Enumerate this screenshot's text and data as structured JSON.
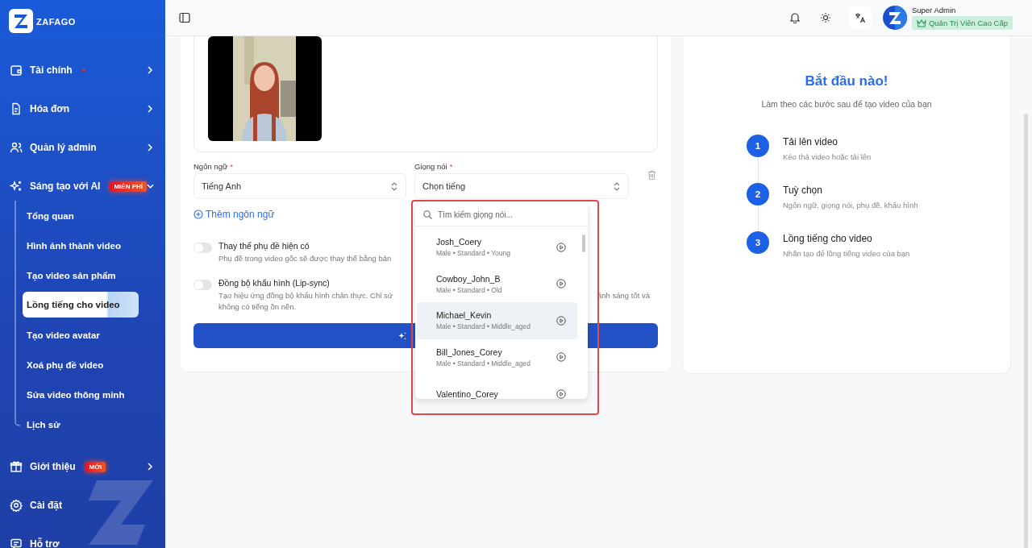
{
  "brand": {
    "name": "ZAFAGO"
  },
  "sidebar": {
    "items": [
      {
        "label": "Tài chính",
        "dot": true,
        "expanded": false
      },
      {
        "label": "Hóa đơn",
        "expanded": false
      },
      {
        "label": "Quản lý admin",
        "expanded": false
      },
      {
        "label": "Sáng tạo với AI",
        "badge": "MIỄN PHÍ",
        "expanded": true,
        "children": [
          {
            "label": "Tổng quan",
            "selected": false
          },
          {
            "label": "Hình ảnh thành video",
            "selected": false
          },
          {
            "label": "Tạo video sản phẩm",
            "selected": false
          },
          {
            "label": "Lồng tiếng cho video",
            "selected": true
          },
          {
            "label": "Tạo video avatar",
            "selected": false
          },
          {
            "label": "Xoá phụ đề video",
            "selected": false
          },
          {
            "label": "Sửa video thông minh",
            "selected": false
          },
          {
            "label": "Lịch sử",
            "selected": false
          }
        ]
      },
      {
        "label": "Giới thiệu",
        "badge": "MỚI",
        "expanded": false
      },
      {
        "label": "Cài đặt"
      },
      {
        "label": "Hỗ trợ"
      }
    ]
  },
  "header": {
    "user_name": "Super Admin",
    "role": "Quản Trị Viên Cao Cấp"
  },
  "form": {
    "language": {
      "label": "Ngôn ngữ",
      "required_mark": "*",
      "value": "Tiếng Anh"
    },
    "voice": {
      "label": "Giọng nói",
      "required_mark": "*",
      "value": "Chọn tiếng"
    },
    "add_language": "Thêm ngôn ngữ",
    "toggles": [
      {
        "title": "Thay thế phụ đề hiện có",
        "on": false,
        "description": "Phụ đề trong video gốc sẽ được thay thế bằng bản"
      },
      {
        "title": "Đồng bộ khẩu hình (Lip-sync)",
        "on": false,
        "description": "Tạo hiệu ứng đồng bộ khẩu hình chân thực. Chỉ sử",
        "description_after": "ánh sáng tốt và",
        "description_line2": "không có tiếng ồn nền."
      }
    ]
  },
  "voice_dropdown": {
    "search_placeholder": "Tìm kiếm giọng nói...",
    "voices": [
      {
        "name": "Josh_Coery",
        "meta": "Male • Standard • Young",
        "selected": false
      },
      {
        "name": "Cowboy_John_B",
        "meta": "Male • Standard • Old",
        "selected": false
      },
      {
        "name": "Michael_Kevin",
        "meta": "Male • Standard • Middle_aged",
        "selected": true
      },
      {
        "name": "Bill_Jones_Corey",
        "meta": "Male • Standard • Middle_aged",
        "selected": false
      },
      {
        "name": "Valentino_Corey",
        "selected": false
      }
    ]
  },
  "guide": {
    "title": "Bắt đầu nào!",
    "subtitle": "Làm theo các bước sau để tạo video của bạn",
    "steps": [
      {
        "number": "1",
        "title": "Tải lên video",
        "description": "Kéo thả video hoặc tải lên"
      },
      {
        "number": "2",
        "title": "Tuỳ chọn",
        "description": "Ngôn ngữ, giọng nói, phụ đề, khẩu hình"
      },
      {
        "number": "3",
        "title": "Lồng tiếng cho video",
        "description": "Nhấn tạo để lồng tiếng video của bạn"
      }
    ]
  }
}
